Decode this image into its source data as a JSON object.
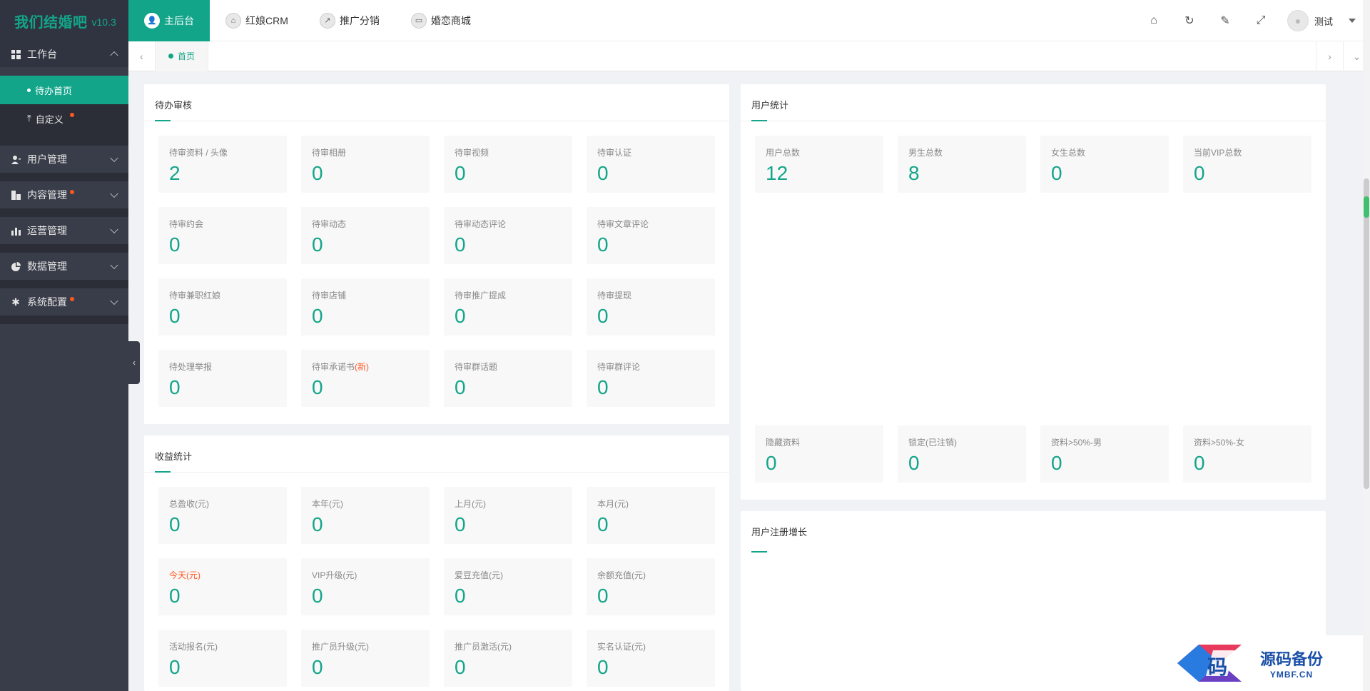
{
  "app": {
    "name": "我们结婚吧",
    "version": "v10.3"
  },
  "sidebar": {
    "workbench": {
      "label": "工作台"
    },
    "sub_items": [
      {
        "label": "待办首页",
        "active": true
      },
      {
        "label": "自定义",
        "dot": true
      }
    ],
    "items": [
      {
        "label": "用户管理",
        "icon": "user-icon"
      },
      {
        "label": "内容管理",
        "icon": "content-icon",
        "dot": true
      },
      {
        "label": "运营管理",
        "icon": "chart-bars-icon"
      },
      {
        "label": "数据管理",
        "icon": "pie-icon"
      },
      {
        "label": "系统配置",
        "icon": "gear-icon",
        "dot": true
      }
    ]
  },
  "header": {
    "tabs": [
      {
        "label": "主后台",
        "active": true
      },
      {
        "label": "红娘CRM"
      },
      {
        "label": "推广分销"
      },
      {
        "label": "婚恋商城"
      }
    ],
    "user": "测试"
  },
  "tabbar": {
    "current": "首页"
  },
  "pending": {
    "title": "待办审核",
    "stats": [
      {
        "label": "待审资料 / 头像",
        "value": "2"
      },
      {
        "label": "待审相册",
        "value": "0"
      },
      {
        "label": "待审视频",
        "value": "0"
      },
      {
        "label": "待审认证",
        "value": "0"
      },
      {
        "label": "待审约会",
        "value": "0"
      },
      {
        "label": "待审动态",
        "value": "0"
      },
      {
        "label": "待审动态评论",
        "value": "0"
      },
      {
        "label": "待审文章评论",
        "value": "0"
      },
      {
        "label": "待审兼职红娘",
        "value": "0"
      },
      {
        "label": "待审店铺",
        "value": "0"
      },
      {
        "label": "待审推广提成",
        "value": "0"
      },
      {
        "label": "待审提现",
        "value": "0"
      },
      {
        "label": "待处理举报",
        "value": "0"
      },
      {
        "label": "待审承诺书",
        "label_suffix": "(新)",
        "value": "0"
      },
      {
        "label": "待审群话题",
        "value": "0"
      },
      {
        "label": "待审群评论",
        "value": "0"
      }
    ]
  },
  "revenue": {
    "title": "收益统计",
    "stats": [
      {
        "label": "总盈收(元)",
        "value": "0"
      },
      {
        "label": "本年(元)",
        "value": "0"
      },
      {
        "label": "上月(元)",
        "value": "0"
      },
      {
        "label": "本月(元)",
        "value": "0"
      },
      {
        "label": "今天(元)",
        "value": "0",
        "red": true
      },
      {
        "label": "VIP升级(元)",
        "value": "0"
      },
      {
        "label": "爱豆充值(元)",
        "value": "0"
      },
      {
        "label": "余额充值(元)",
        "value": "0"
      },
      {
        "label": "活动报名(元)",
        "value": "0"
      },
      {
        "label": "推广员升级(元)",
        "value": "0"
      },
      {
        "label": "推广员激活(元)",
        "value": "0"
      },
      {
        "label": "实名认证(元)",
        "value": "0"
      }
    ]
  },
  "users": {
    "title": "用户统计",
    "top": [
      {
        "label": "用户总数",
        "value": "12"
      },
      {
        "label": "男生总数",
        "value": "8"
      },
      {
        "label": "女生总数",
        "value": "0"
      },
      {
        "label": "当前VIP总数",
        "value": "0"
      }
    ],
    "bottom": [
      {
        "label": "隐藏资料",
        "value": "0"
      },
      {
        "label": "锁定(已注销)",
        "value": "0"
      },
      {
        "label": "资料>50%-男",
        "value": "0"
      },
      {
        "label": "资料>50%-女",
        "value": "0"
      }
    ]
  },
  "growth": {
    "title": "用户注册增长"
  },
  "watermark": {
    "cn": "源码备份",
    "en": "YMBF.CN",
    "logo_char": "码"
  },
  "colors": {
    "accent": "#13a58a",
    "sidebar": "#393d49",
    "dot": "#ff5722"
  }
}
